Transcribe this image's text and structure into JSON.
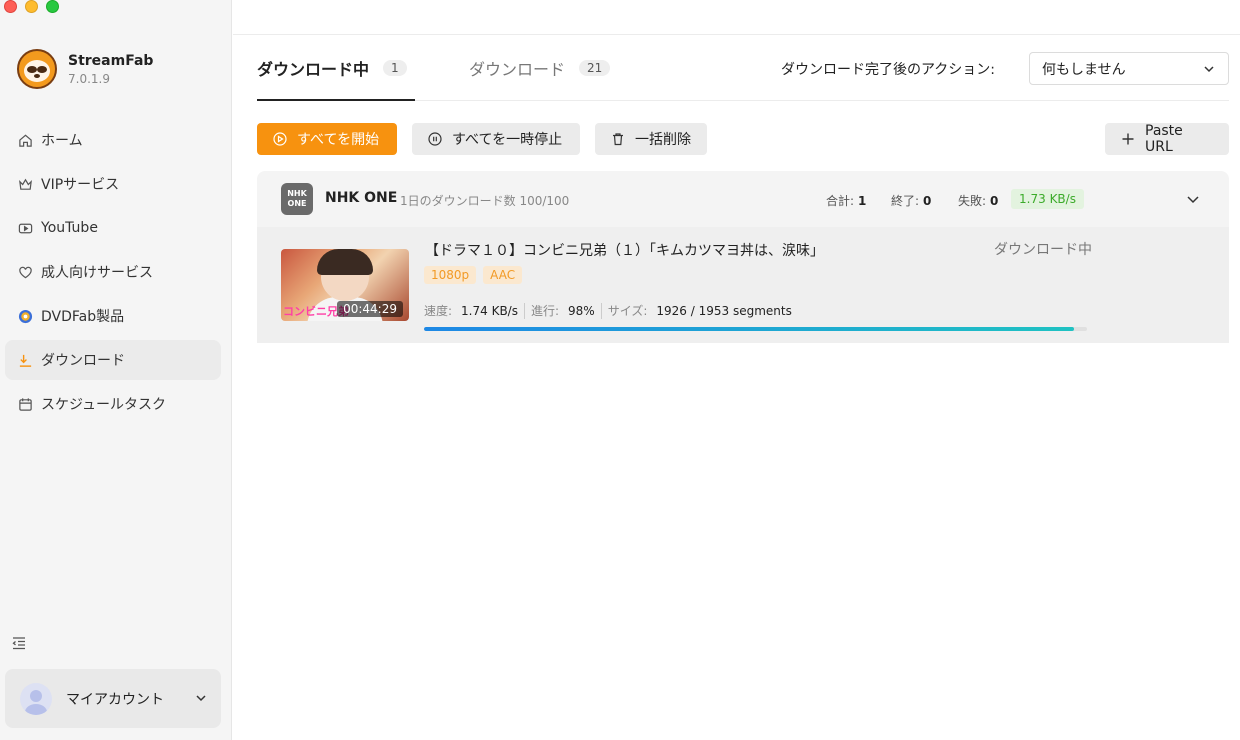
{
  "app": {
    "name": "StreamFab",
    "version": "7.0.1.9"
  },
  "sidebar": {
    "items": [
      {
        "label": "ホーム",
        "icon": "home-icon"
      },
      {
        "label": "VIPサービス",
        "icon": "crown-icon"
      },
      {
        "label": "YouTube",
        "icon": "youtube-icon"
      },
      {
        "label": "成人向けサービス",
        "icon": "heart-icon"
      },
      {
        "label": "DVDFab製品",
        "icon": "dvdfab-icon"
      },
      {
        "label": "ダウンロード",
        "icon": "download-icon",
        "active": true
      },
      {
        "label": "スケジュールタスク",
        "icon": "calendar-icon"
      }
    ],
    "account_label": "マイアカウント"
  },
  "tabs": [
    {
      "label": "ダウンロード中",
      "count": "1",
      "active": true
    },
    {
      "label": "ダウンロード",
      "count": "21",
      "active": false
    }
  ],
  "after_action": {
    "label": "ダウンロード完了後のアクション:",
    "selected": "何もしません"
  },
  "toolbar": {
    "start_all": "すべてを開始",
    "pause_all": "すべてを一時停止",
    "delete_all": "一括削除",
    "paste_url": "Paste URL"
  },
  "group": {
    "logo_text_top": "NHK",
    "logo_text_bottom": "ONE",
    "service_name": "NHK ONE",
    "quota": "1日のダウンロード数 100/100",
    "total_label": "合計:",
    "total_value": "1",
    "done_label": "終了:",
    "done_value": "0",
    "fail_label": "失敗:",
    "fail_value": "0",
    "speed": "1.73 KB/s"
  },
  "item": {
    "title": "【ドラマ１０】コンビニ兄弟（１）「キムカツマヨ丼は、涙味」",
    "status": "ダウンロード中",
    "duration": "00:44:29",
    "thumb_caption": "コンビニ兄弟",
    "tags": [
      "1080p",
      "AAC"
    ],
    "speed_label": "速度:",
    "speed_value": "1.74 KB/s",
    "progress_label": "進行:",
    "progress_value": "98%",
    "size_label": "サイズ:",
    "size_value": "1926 / 1953 segments",
    "progress_fraction": 0.98
  },
  "colors": {
    "accent": "#f7920f",
    "speed_badge_text": "#3cab2a",
    "progress_start": "#1e88e5",
    "progress_end": "#1fc2c2"
  }
}
